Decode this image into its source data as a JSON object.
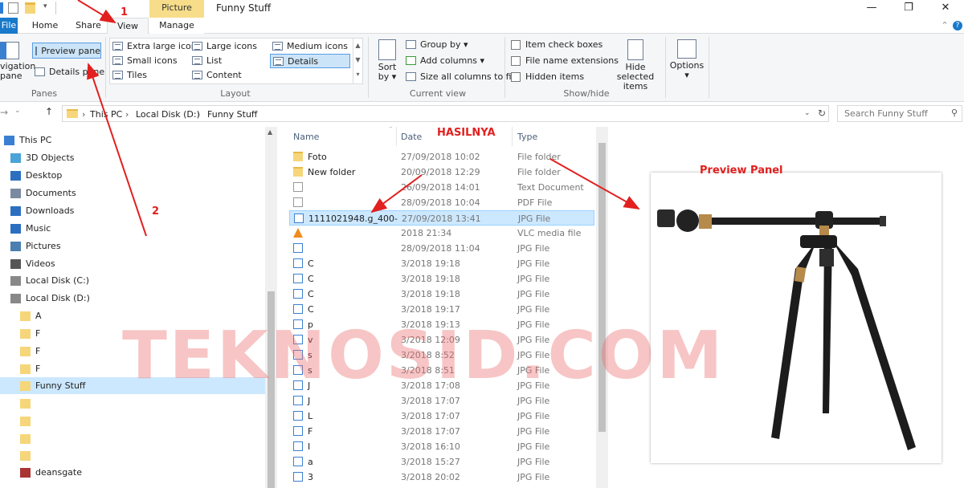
{
  "window": {
    "title": "Funny Stuff",
    "context_tab": "Picture Tools",
    "min": "—",
    "max": "❐",
    "close": "✕",
    "help": "?"
  },
  "tabs": {
    "file": "File",
    "home": "Home",
    "share": "Share",
    "view": "View",
    "manage": "Manage"
  },
  "ribbon": {
    "panes": {
      "label": "Panes",
      "navigation": "vigation",
      "navigation2": "pane",
      "preview": "Preview pane",
      "details": "Details pane"
    },
    "layout": {
      "label": "Layout",
      "extra_large": "Extra large icons",
      "large": "Large icons",
      "medium": "Medium icons",
      "small": "Small icons",
      "list": "List",
      "details": "Details",
      "tiles": "Tiles",
      "content": "Content"
    },
    "current_view": {
      "label": "Current view",
      "sort": "Sort",
      "sort2": "by",
      "group": "Group by",
      "add_cols": "Add columns",
      "size_cols": "Size all columns to fit"
    },
    "show_hide": {
      "label": "Show/hide",
      "item_checkboxes": "Item check boxes",
      "file_ext": "File name extensions",
      "hidden": "Hidden items",
      "hide_sel": "Hide selected",
      "hide_sel2": "items"
    },
    "options": "Options"
  },
  "address": {
    "crumbs": [
      "This PC",
      "Local Disk (D:)",
      "Funny Stuff"
    ],
    "search_placeholder": "Search Funny Stuff"
  },
  "nav": [
    {
      "label": "This PC",
      "icon": "pc-icon"
    },
    {
      "label": "3D Objects",
      "icon": "cube-icon"
    },
    {
      "label": "Desktop",
      "icon": "desktop-icon"
    },
    {
      "label": "Documents",
      "icon": "documents-icon"
    },
    {
      "label": "Downloads",
      "icon": "downloads-icon"
    },
    {
      "label": "Music",
      "icon": "music-icon"
    },
    {
      "label": "Pictures",
      "icon": "pictures-icon"
    },
    {
      "label": "Videos",
      "icon": "videos-icon"
    },
    {
      "label": "Local Disk (C:)",
      "icon": "drive-icon"
    },
    {
      "label": "Local Disk (D:)",
      "icon": "drive-icon"
    },
    {
      "label": "A",
      "icon": "folder-icon"
    },
    {
      "label": "F",
      "icon": "folder-icon"
    },
    {
      "label": "F",
      "icon": "folder-icon"
    },
    {
      "label": "F",
      "icon": "folder-icon"
    },
    {
      "label": "Funny Stuff",
      "icon": "folder-icon"
    },
    {
      "label": "",
      "icon": "folder-icon"
    },
    {
      "label": "",
      "icon": "folder-icon"
    },
    {
      "label": "",
      "icon": "folder-icon"
    },
    {
      "label": "",
      "icon": "folder-icon"
    },
    {
      "label": "deansgate",
      "icon": "archive-icon"
    }
  ],
  "columns": {
    "name": "Name",
    "date": "Date",
    "type": "Type"
  },
  "files": [
    {
      "name": "Foto",
      "date": "27/09/2018 10:02",
      "type": "File folder",
      "icon": "folder-icon"
    },
    {
      "name": "New folder",
      "date": "20/09/2018 12:29",
      "type": "File folder",
      "icon": "folder-icon"
    },
    {
      "name": "",
      "date": "26/09/2018 14:01",
      "type": "Text Document",
      "icon": "text-icon"
    },
    {
      "name": "",
      "date": "28/09/2018 10:04",
      "type": "PDF File",
      "icon": "pdf-icon"
    },
    {
      "name": "1111021948.g_400-",
      "date": "27/09/2018 13:41",
      "type": "JPG File",
      "icon": "image-icon"
    },
    {
      "name": "",
      "date": "2018 21:34",
      "type": "VLC media file",
      "icon": "vlc-icon"
    },
    {
      "name": "",
      "date": "28/09/2018 11:04",
      "type": "JPG File",
      "icon": "image-icon"
    },
    {
      "name": "C",
      "date": "3/2018 19:18",
      "type": "JPG File",
      "icon": "image-icon"
    },
    {
      "name": "C",
      "date": "3/2018 19:18",
      "type": "JPG File",
      "icon": "image-icon"
    },
    {
      "name": "C",
      "date": "3/2018 19:18",
      "type": "JPG File",
      "icon": "image-icon"
    },
    {
      "name": "C",
      "date": "3/2018 19:17",
      "type": "JPG File",
      "icon": "image-icon"
    },
    {
      "name": "p",
      "date": "3/2018 19:13",
      "type": "JPG File",
      "icon": "image-icon"
    },
    {
      "name": "v",
      "date": "3/2018 12:09",
      "type": "JPG File",
      "icon": "image-icon"
    },
    {
      "name": "s",
      "date": "3/2018 8:52",
      "type": "JPG File",
      "icon": "image-icon"
    },
    {
      "name": "s",
      "date": "3/2018 8:51",
      "type": "JPG File",
      "icon": "image-icon"
    },
    {
      "name": "J",
      "date": "3/2018 17:08",
      "type": "JPG File",
      "icon": "image-icon"
    },
    {
      "name": "J",
      "date": "3/2018 17:07",
      "type": "JPG File",
      "icon": "image-icon"
    },
    {
      "name": "L",
      "date": "3/2018 17:07",
      "type": "JPG File",
      "icon": "image-icon"
    },
    {
      "name": "F",
      "date": "3/2018 17:07",
      "type": "JPG File",
      "icon": "image-icon"
    },
    {
      "name": "I",
      "date": "3/2018 16:10",
      "type": "JPG File",
      "icon": "image-icon"
    },
    {
      "name": "a",
      "date": "3/2018 15:27",
      "type": "JPG File",
      "icon": "image-icon"
    },
    {
      "name": "3",
      "date": "3/2018 20:02",
      "type": "JPG File",
      "icon": "image-icon"
    }
  ],
  "annotations": {
    "step1": "1",
    "step2": "2",
    "hasilnya": "HASILNYA",
    "preview_panel": "Preview Panel",
    "watermark": "TEKNOSID.COM"
  },
  "colors": {
    "accent": "#1979ca",
    "arrow": "#e1201f",
    "selection": "#cce8ff",
    "context_tab": "#f7dd8a"
  }
}
